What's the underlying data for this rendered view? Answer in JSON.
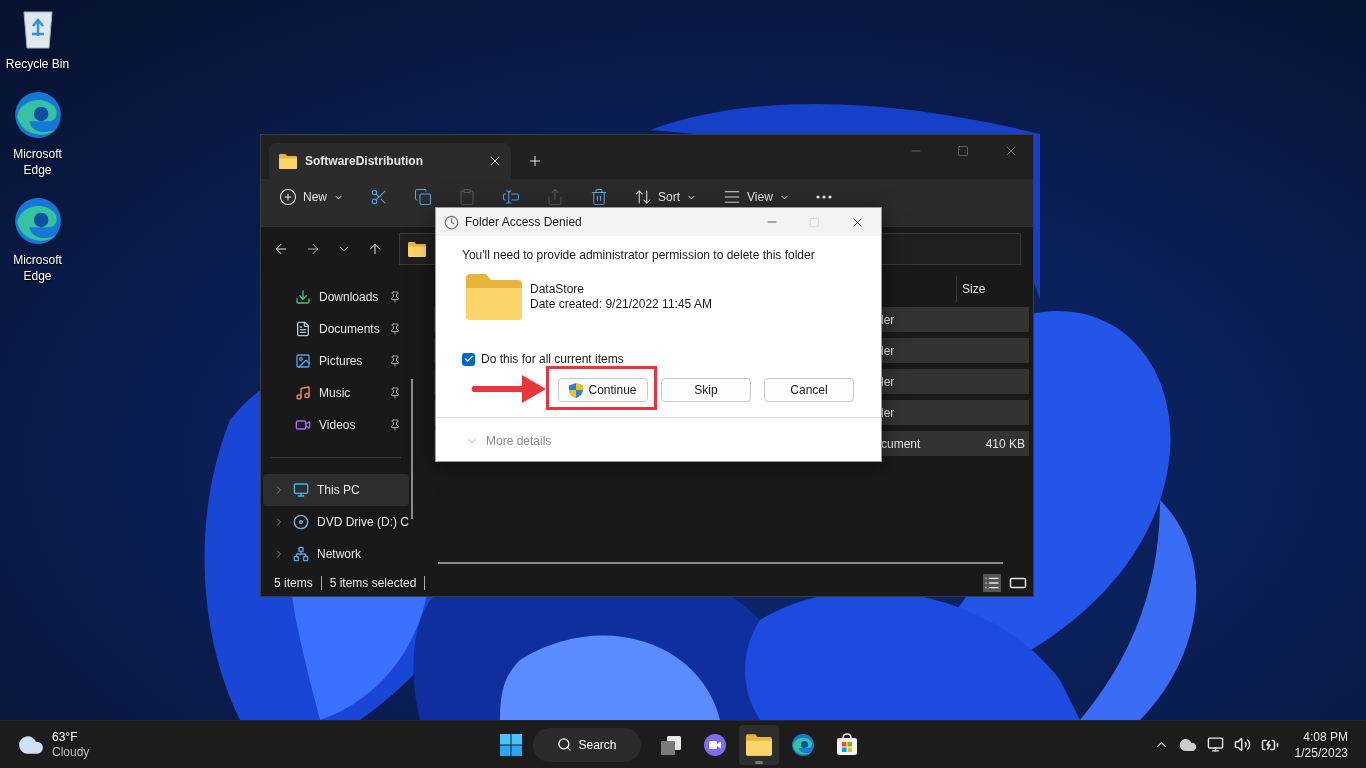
{
  "desktop_icons": [
    {
      "label": "Recycle Bin",
      "kind": "recycle"
    },
    {
      "label": "Microsoft Edge",
      "kind": "edge"
    },
    {
      "label": "Microsoft Edge",
      "kind": "edge"
    }
  ],
  "explorer": {
    "tab_title": "SoftwareDistribution",
    "toolbar": [
      {
        "kind": "new",
        "label": "New",
        "disabled": false
      },
      {
        "kind": "cut",
        "disabled": false
      },
      {
        "kind": "copy",
        "disabled": false
      },
      {
        "kind": "paste",
        "disabled": true
      },
      {
        "kind": "rename",
        "disabled": false
      },
      {
        "kind": "share",
        "disabled": true
      },
      {
        "kind": "delete",
        "disabled": false
      },
      {
        "kind": "sort",
        "label": "Sort",
        "disabled": false
      },
      {
        "kind": "view",
        "label": "View",
        "disabled": false
      },
      {
        "kind": "more",
        "disabled": false
      }
    ],
    "sidebar": {
      "pinned": [
        {
          "label": "Downloads",
          "kind": "downloads"
        },
        {
          "label": "Documents",
          "kind": "documents"
        },
        {
          "label": "Pictures",
          "kind": "pictures"
        },
        {
          "label": "Music",
          "kind": "music"
        },
        {
          "label": "Videos",
          "kind": "videos"
        }
      ],
      "locations": [
        {
          "label": "This PC",
          "kind": "pc",
          "selected": true
        },
        {
          "label": "DVD Drive (D:) C",
          "kind": "dvd",
          "selected": false
        },
        {
          "label": "Network",
          "kind": "network",
          "selected": false
        }
      ]
    },
    "file_list": {
      "columns": [
        "Size"
      ],
      "rows": [
        {
          "column_1": "ler",
          "selected": true
        },
        {
          "column_1": "ler",
          "selected": true
        },
        {
          "column_1": "ler",
          "selected": true
        },
        {
          "column_1": "ler",
          "selected": true
        },
        {
          "column_1": "cument",
          "size": "410 KB",
          "selected": true
        }
      ]
    },
    "status_bar": {
      "items": "5 items",
      "selected": "5 items selected"
    }
  },
  "dialog": {
    "title": "Folder Access Denied",
    "message": "You'll need to provide administrator permission to delete this folder",
    "item_name": "DataStore",
    "item_date": "Date created: 9/21/2022 11:45 AM",
    "checkbox": {
      "label": "Do this for all current items",
      "checked": true
    },
    "buttons": [
      {
        "label": "Continue",
        "kind": "shield"
      },
      {
        "label": "Skip",
        "kind": "plain"
      },
      {
        "label": "Cancel",
        "kind": "plain"
      }
    ],
    "more_details": "More details"
  },
  "taskbar": {
    "weather": {
      "temperature": "63°F",
      "condition": "Cloudy"
    },
    "search": "Search",
    "apps": [
      {
        "kind": "taskview",
        "selected": false
      },
      {
        "kind": "chat",
        "selected": false
      },
      {
        "kind": "explorer",
        "selected": true
      },
      {
        "kind": "edge",
        "selected": false
      },
      {
        "kind": "store",
        "selected": false
      }
    ],
    "clock": {
      "time": "4:08 PM",
      "date": "1/25/2023"
    }
  }
}
